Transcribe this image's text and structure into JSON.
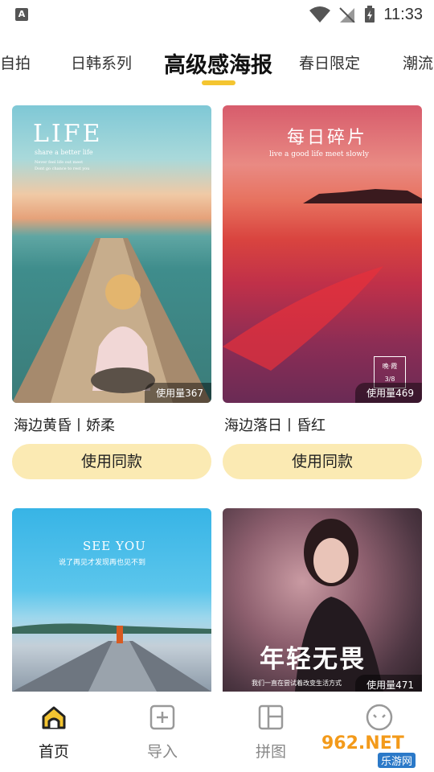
{
  "status_bar": {
    "app_badge": "A",
    "time": "11:33"
  },
  "tabs": [
    {
      "label": "自拍",
      "active": false
    },
    {
      "label": "日韩系列",
      "active": false
    },
    {
      "label": "高级感海报",
      "active": true
    },
    {
      "label": "春日限定",
      "active": false
    },
    {
      "label": "潮流",
      "active": false
    }
  ],
  "cards": [
    {
      "title": "海边黄昏丨娇柔",
      "usage": "使用量367",
      "button": "使用同款",
      "overlay": {
        "line1": "LIFE",
        "line2": "share a better life",
        "line3": "Never feel life out meet",
        "line4": "Dont go chance to rest you"
      }
    },
    {
      "title": "海边落日丨昏红",
      "usage": "使用量469",
      "button": "使用同款",
      "overlay": {
        "line1": "每日碎片",
        "line2": "live a good  life meet slowly",
        "stamp_top": "晚·霞",
        "stamp_bottom": "3/8"
      }
    },
    {
      "title": "",
      "usage": "",
      "button": "",
      "overlay": {
        "line1": "SEE YOU",
        "line2": "说了再见才发现再也见不到"
      }
    },
    {
      "title": "",
      "usage": "使用量471",
      "button": "",
      "overlay": {
        "line1": "年轻无畏",
        "line2": "我们一直在尝试着改变生活方式"
      }
    }
  ],
  "bottom_nav": [
    {
      "label": "首页",
      "icon": "home-icon",
      "active": true
    },
    {
      "label": "导入",
      "icon": "add-square-icon",
      "active": false
    },
    {
      "label": "拼图",
      "icon": "grid-layout-icon",
      "active": false
    },
    {
      "label": "",
      "icon": "face-icon",
      "active": false
    }
  ],
  "watermark": {
    "text_top": "962.NET",
    "text_bottom": "乐游网"
  },
  "colors": {
    "accent": "#f4c531",
    "button_bg": "#fbeab3",
    "text_primary": "#222222",
    "text_muted": "#888888"
  }
}
